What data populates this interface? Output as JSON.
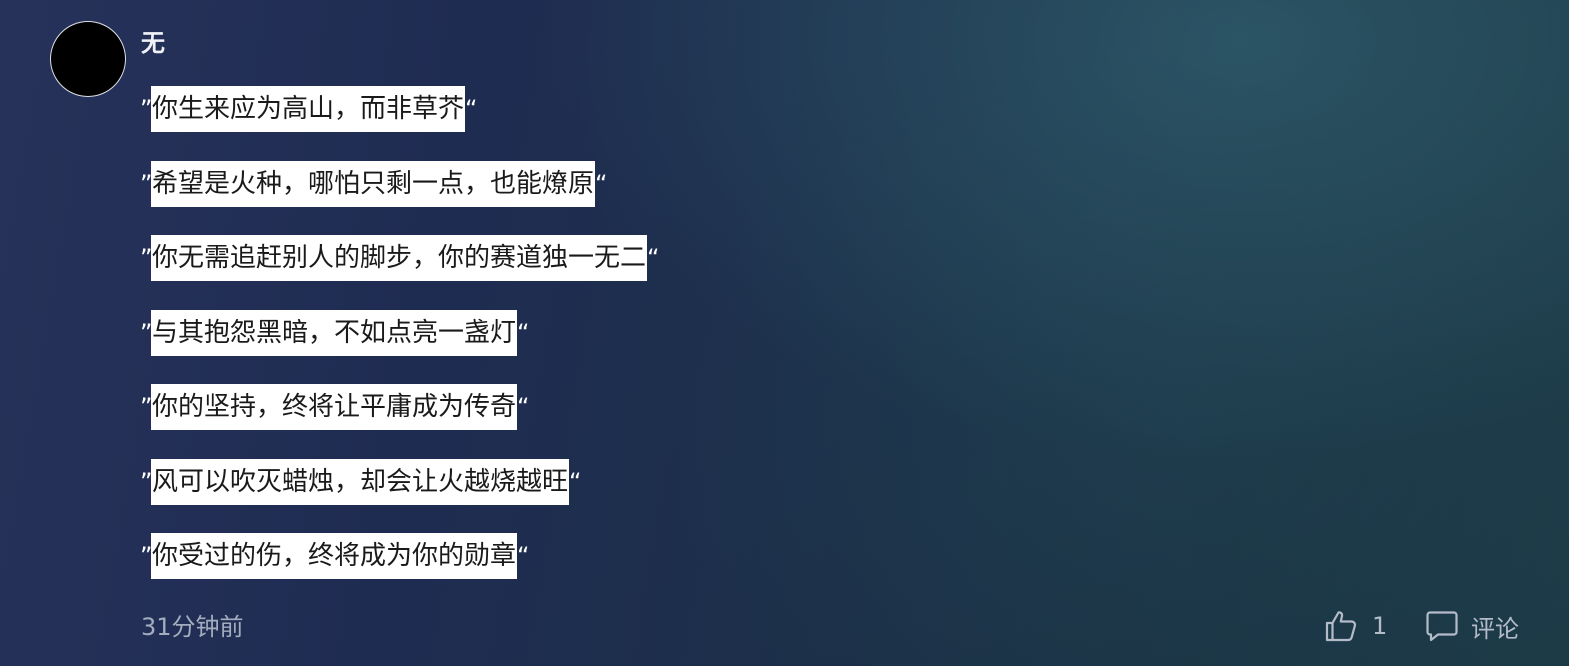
{
  "post": {
    "username": "无",
    "quote_open": "”",
    "quote_close": "“",
    "quotes": [
      "你生来应为高山，而非草芥",
      "希望是火种，哪怕只剩一点，也能燎原",
      "你无需追赶别人的脚步，你的赛道独一无二",
      "与其抱怨黑暗，不如点亮一盏灯",
      "你的坚持，终将让平庸成为传奇",
      "风可以吹灭蜡烛，却会让火越烧越旺",
      "你受过的伤，终将成为你的勋章"
    ],
    "timestamp": "31分钟前",
    "like_count": "1",
    "comment_label": "评论"
  },
  "icons": {
    "like": "thumbs-up-icon",
    "comment": "comment-bubble-icon"
  },
  "colors": {
    "highlight": "#ffffff",
    "meta_text": "#a3adbd",
    "background_deep": "#1f2c52",
    "background_teal": "#1d3a47"
  }
}
